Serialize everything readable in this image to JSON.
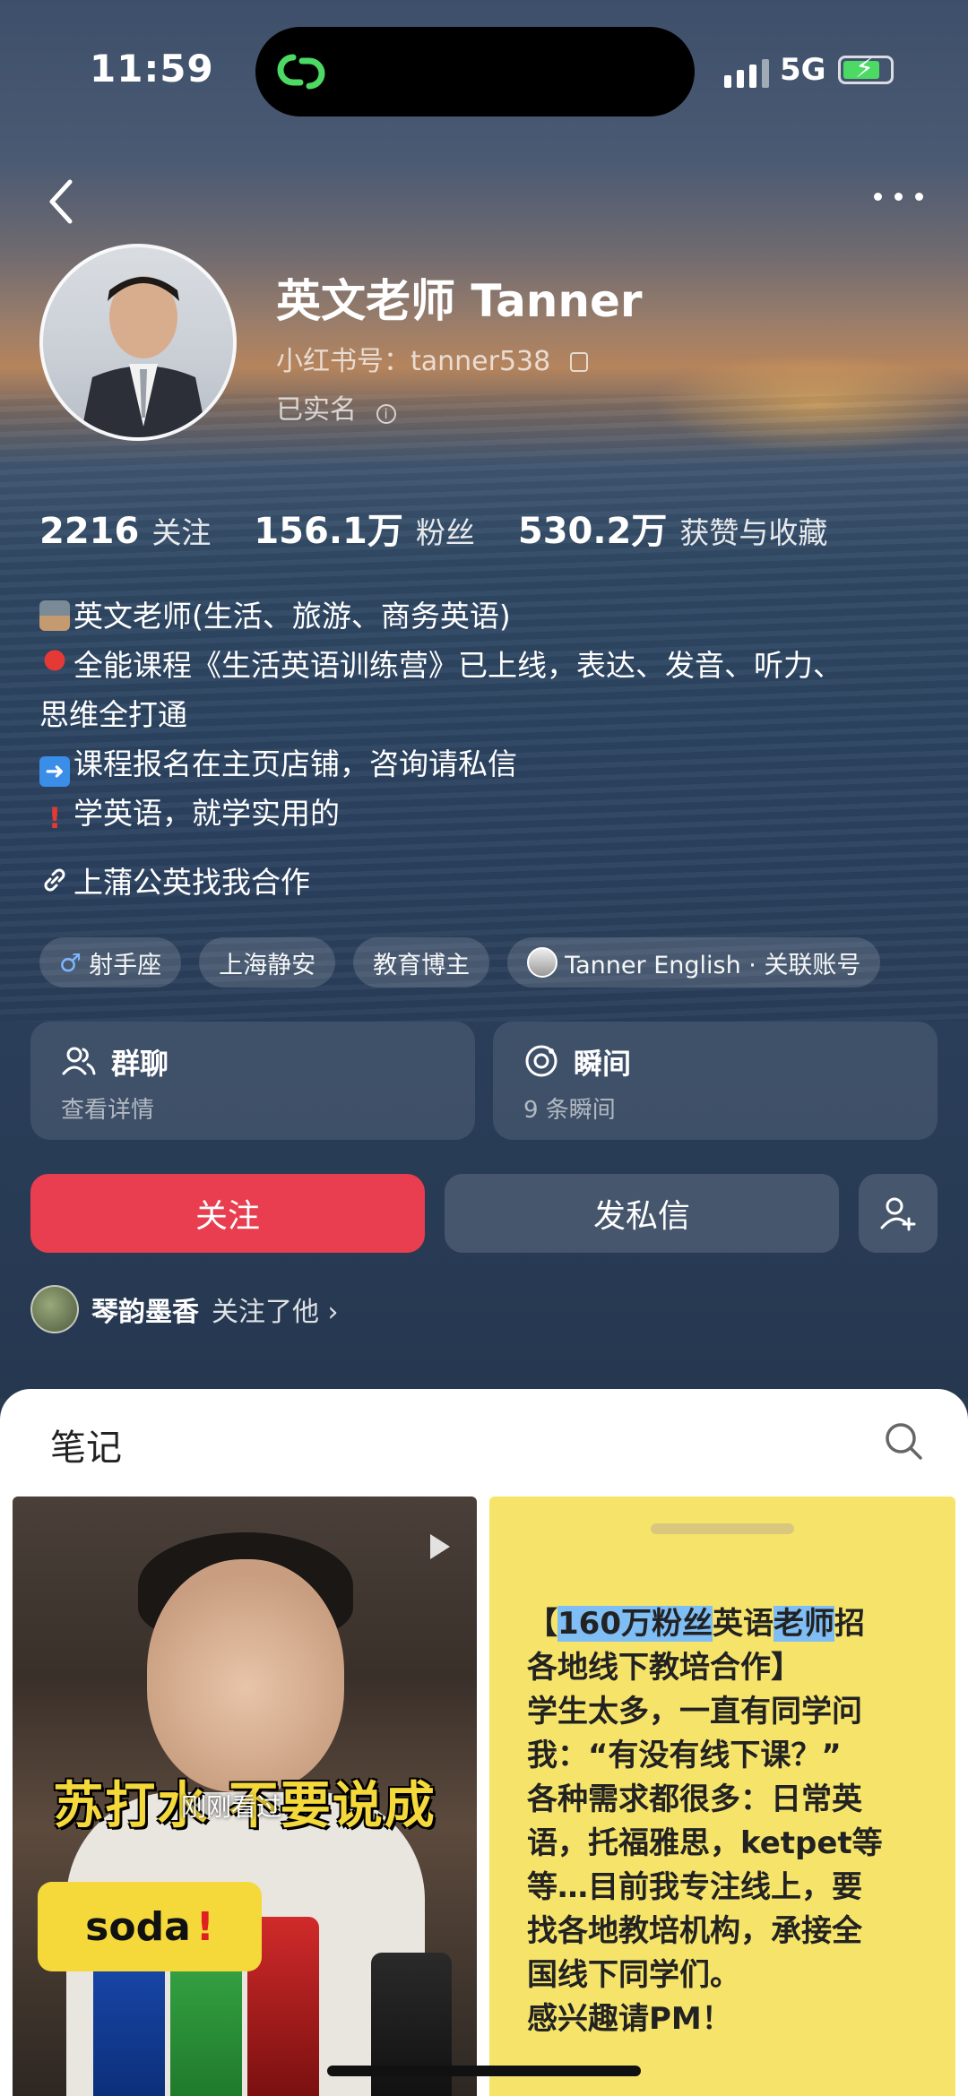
{
  "status_bar": {
    "time": "11:59",
    "network": "5G"
  },
  "profile": {
    "name": "英文老师 Tanner",
    "red_id": "小红书号：tanner538",
    "verified": "已实名"
  },
  "stats": [
    {
      "value": "2216",
      "label": "关注"
    },
    {
      "value": "156.1万",
      "label": "粉丝"
    },
    {
      "value": "530.2万",
      "label": "获赞与收藏"
    }
  ],
  "bio": {
    "line1": "英文老师(生活、旅游、商务英语)",
    "line2": "全能课程《生活英语训练营》已上线，表达、发音、听力、",
    "line3": "思维全打通",
    "line4": "课程报名在主页店铺，咨询请私信",
    "line5": "学英语，就学实用的"
  },
  "link_text": "上蒲公英找我合作",
  "tags": {
    "zodiac": "射手座",
    "location": "上海静安",
    "category": "教育博主",
    "linked_account": "Tanner English · 关联账号"
  },
  "cards": {
    "group_chat": {
      "title": "群聊",
      "subtitle": "查看详情"
    },
    "moments": {
      "title": "瞬间",
      "subtitle": "9 条瞬间"
    }
  },
  "buttons": {
    "follow": "关注",
    "message": "发私信"
  },
  "mutual": {
    "name": "琴韵墨香",
    "text": "关注了他 ›"
  },
  "notes_section": {
    "title": "笔记"
  },
  "note_left": {
    "caption": "苏打水  不要说成",
    "seen": "刚刚看过",
    "word": "soda",
    "exclaim": "!"
  },
  "note_right": {
    "hl1": "160万粉丝",
    "t1": "英语",
    "hl2": "老师",
    "t2": "招",
    "line2": "各地线下教培合作】",
    "line3": "学生太多，一直有同学问",
    "line4": "我：“有没有线下课？”",
    "line5": "各种需求都很多：日常英",
    "line6": "语，托福雅思，ketpet等",
    "line7": "等…目前我专注线上，要",
    "line8": "找各地教培机构，承接全",
    "line9": "国线下同学们。",
    "line10": "感兴趣请PM！"
  },
  "colors": {
    "accent_red": "#e83e4f",
    "highlight": "#7fbdf5",
    "note_yellow": "#f6e46a"
  }
}
